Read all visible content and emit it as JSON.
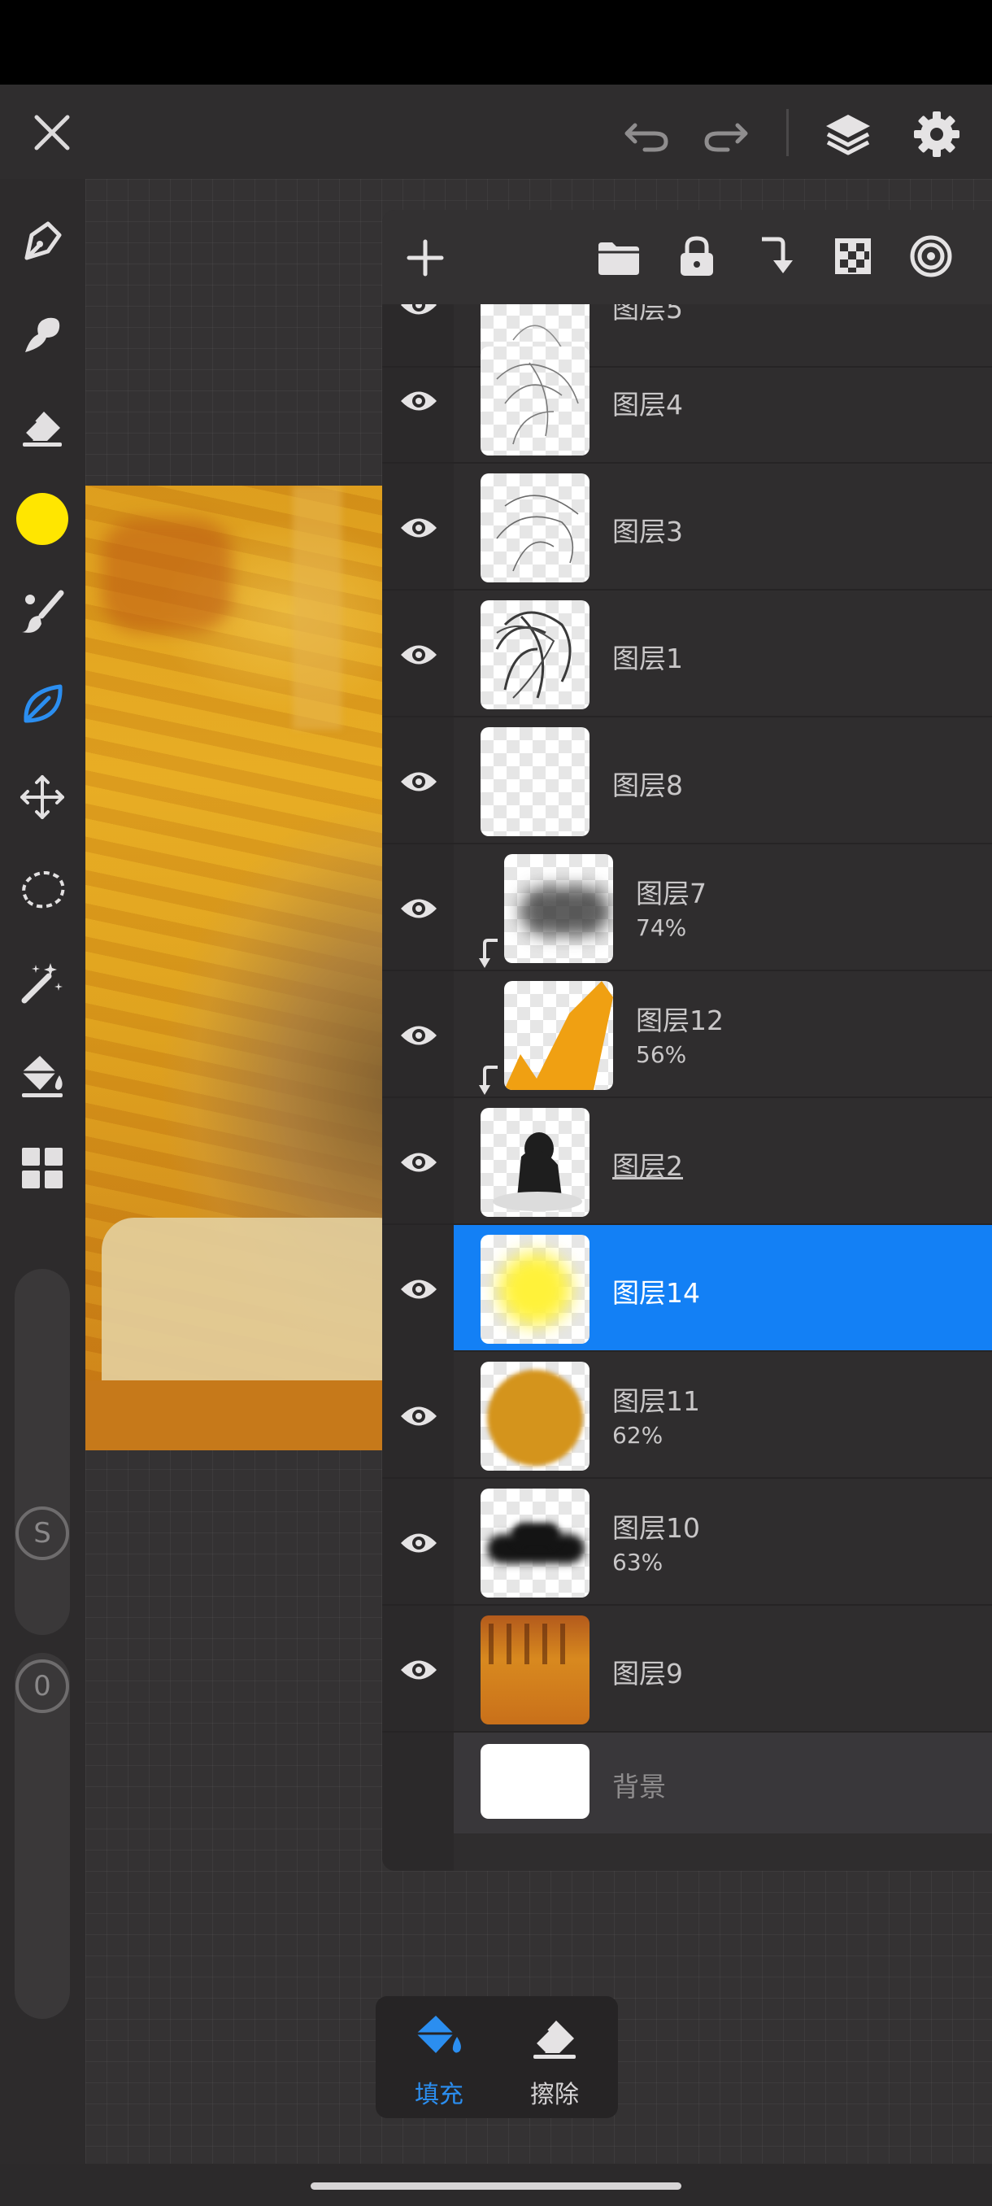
{
  "toolbar": {
    "color_swatch": "#ffe600",
    "active_tool_color": "#2b8ef0",
    "slider_top_label": "S",
    "slider_bottom_label": "0"
  },
  "layers_panel": {
    "layers": [
      {
        "name": "图层5",
        "opacity": "",
        "visible": true,
        "clipped": false,
        "selected": false
      },
      {
        "name": "图层4",
        "opacity": "",
        "visible": true,
        "clipped": false,
        "selected": false
      },
      {
        "name": "图层3",
        "opacity": "",
        "visible": true,
        "clipped": false,
        "selected": false
      },
      {
        "name": "图层1",
        "opacity": "",
        "visible": true,
        "clipped": false,
        "selected": false
      },
      {
        "name": "图层8",
        "opacity": "",
        "visible": true,
        "clipped": false,
        "selected": false
      },
      {
        "name": "图层7",
        "opacity": "74%",
        "visible": true,
        "clipped": true,
        "selected": false
      },
      {
        "name": "图层12",
        "opacity": "56%",
        "visible": true,
        "clipped": true,
        "selected": false
      },
      {
        "name": "图层2",
        "opacity": "",
        "visible": true,
        "clipped": false,
        "selected": false
      },
      {
        "name": "图层14",
        "opacity": "",
        "visible": true,
        "clipped": false,
        "selected": true
      },
      {
        "name": "图层11",
        "opacity": "62%",
        "visible": true,
        "clipped": false,
        "selected": false
      },
      {
        "name": "图层10",
        "opacity": "63%",
        "visible": true,
        "clipped": false,
        "selected": false
      },
      {
        "name": "图层9",
        "opacity": "",
        "visible": true,
        "clipped": false,
        "selected": false
      }
    ],
    "background_layer": {
      "name": "背景",
      "visible": false
    },
    "selected_color": "#1380f5"
  },
  "bottom_bar": {
    "fill_label": "填充",
    "erase_label": "擦除",
    "active_color": "#2b8ef0"
  }
}
